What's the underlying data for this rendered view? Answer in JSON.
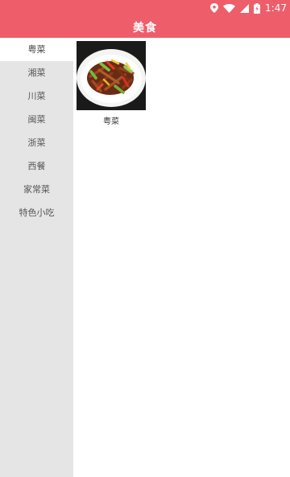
{
  "status_bar": {
    "time": "1:47",
    "icons": [
      "location-icon",
      "wifi-icon",
      "signal-icon",
      "battery-icon"
    ]
  },
  "toolbar": {
    "title": "美食",
    "color": "#ee5d6a"
  },
  "sidebar": {
    "items": [
      {
        "label": "粤菜",
        "selected": true
      },
      {
        "label": "湘菜",
        "selected": false
      },
      {
        "label": "川菜",
        "selected": false
      },
      {
        "label": "闽菜",
        "selected": false
      },
      {
        "label": "浙菜",
        "selected": false
      },
      {
        "label": "西餐",
        "selected": false
      },
      {
        "label": "家常菜",
        "selected": false
      },
      {
        "label": "特色小吃",
        "selected": false
      }
    ]
  },
  "content": {
    "dishes": [
      {
        "name": "粤菜",
        "image": "stir-fry-dish-photo"
      }
    ]
  }
}
